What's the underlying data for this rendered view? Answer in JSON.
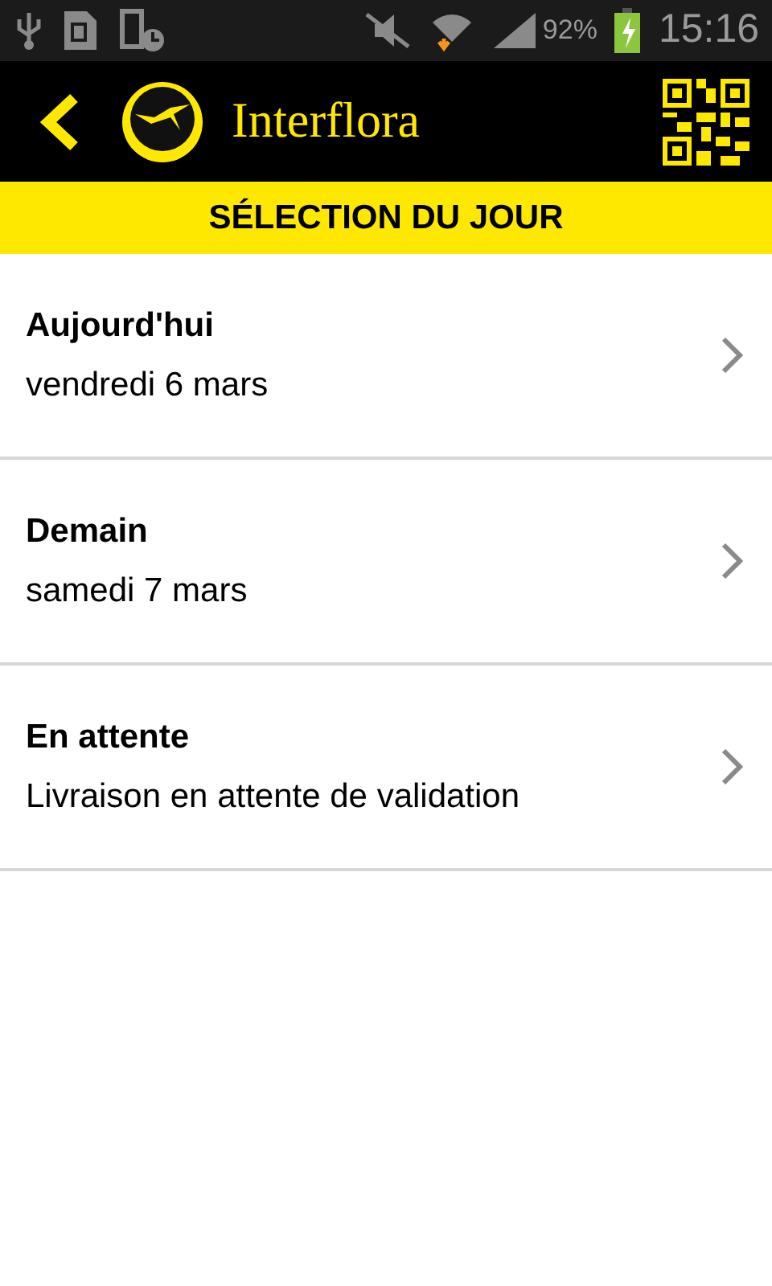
{
  "status_bar": {
    "battery": "92%",
    "time": "15:16"
  },
  "header": {
    "title": "Interflora"
  },
  "section_title": "SÉLECTION DU JOUR",
  "items": [
    {
      "title": "Aujourd'hui",
      "subtitle": "vendredi 6 mars"
    },
    {
      "title": "Demain",
      "subtitle": "samedi 7 mars"
    },
    {
      "title": "En attente",
      "subtitle": "Livraison en attente de validation"
    }
  ]
}
